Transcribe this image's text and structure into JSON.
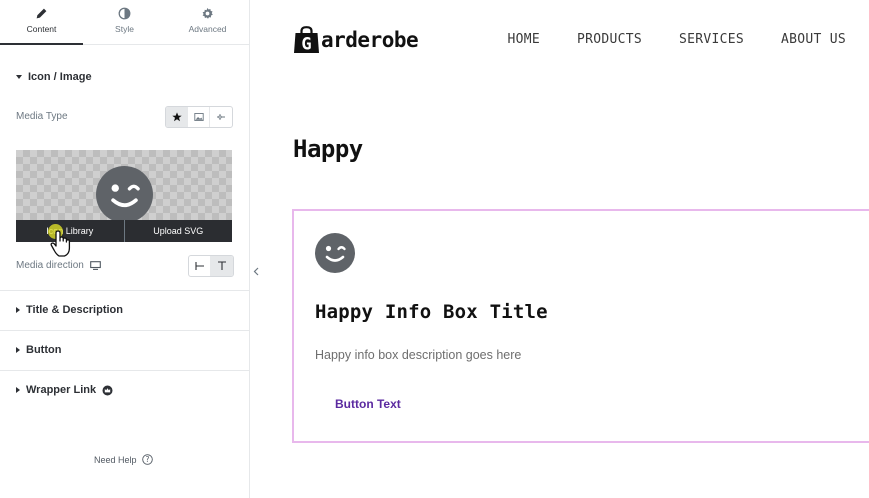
{
  "panel": {
    "tabs": [
      {
        "label": "Content",
        "icon": "pencil-icon"
      },
      {
        "label": "Style",
        "icon": "half-circle-icon"
      },
      {
        "label": "Advanced",
        "icon": "gear-icon"
      }
    ],
    "sections": {
      "icon_image": "Icon / Image",
      "title_description": "Title & Description",
      "button": "Button",
      "wrapper_link": "Wrapper Link"
    },
    "media_type_label": "Media Type",
    "media_type_options": [
      "star-icon",
      "image-icon",
      "svg-path-icon"
    ],
    "preview_actions": {
      "icon_library": "Icon Library",
      "upload_svg": "Upload SVG"
    },
    "media_direction_label": "Media direction",
    "need_help": "Need Help"
  },
  "site": {
    "logo_text": "arderobe",
    "logo_letter": "G",
    "nav": [
      "HOME",
      "PRODUCTS",
      "SERVICES",
      "ABOUT US"
    ],
    "page_heading": "Happy",
    "info_box": {
      "title": "Happy Info Box Title",
      "description": "Happy info box description goes here",
      "button": "Button Text"
    }
  },
  "colors": {
    "icon_gray": "#5f6368",
    "box_border": "#e8b8ec",
    "button_purple": "#5b2aa0",
    "panel_dark": "#2b2d31"
  }
}
